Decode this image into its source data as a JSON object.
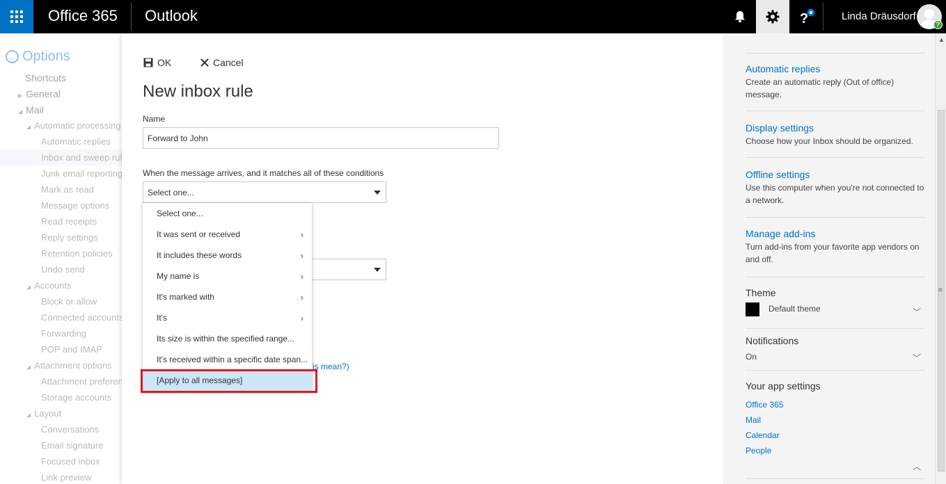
{
  "topbar": {
    "brand": "Office 365",
    "app": "Outlook",
    "user": "Linda Dräusdorf",
    "avatar_badge": "?",
    "icons": [
      "waffle-icon",
      "bell-icon",
      "gear-icon",
      "help-icon"
    ],
    "accent": "#0072c6"
  },
  "leftnav": {
    "title": "Options",
    "items": [
      {
        "label": "Shortcuts"
      },
      {
        "label": "General"
      },
      {
        "label": "Mail"
      },
      {
        "label": "Automatic processing"
      },
      {
        "label": "Automatic replies"
      },
      {
        "label": "Inbox and sweep rules"
      },
      {
        "label": "Junk email reporting"
      },
      {
        "label": "Mark as read"
      },
      {
        "label": "Message options"
      },
      {
        "label": "Read receipts"
      },
      {
        "label": "Reply settings"
      },
      {
        "label": "Retention policies"
      },
      {
        "label": "Undo send"
      },
      {
        "label": "Accounts"
      },
      {
        "label": "Block or allow"
      },
      {
        "label": "Connected accounts"
      },
      {
        "label": "Forwarding"
      },
      {
        "label": "POP and IMAP"
      },
      {
        "label": "Attachment options"
      },
      {
        "label": "Attachment preferences"
      },
      {
        "label": "Storage accounts"
      },
      {
        "label": "Layout"
      },
      {
        "label": "Conversations"
      },
      {
        "label": "Email signature"
      },
      {
        "label": "Focused inbox"
      },
      {
        "label": "Link preview"
      }
    ]
  },
  "main": {
    "ok_label": "OK",
    "cancel_label": "Cancel",
    "title": "New inbox rule",
    "name_label": "Name",
    "name_value": "Forward to John",
    "conditions_label": "When the message arrives, and it matches all of these conditions",
    "conditions_value": "Select one...",
    "second_select_value": "",
    "help_link": "is mean?)"
  },
  "menu": {
    "items": [
      {
        "label": "Select one...",
        "submenu": false
      },
      {
        "label": "It was sent or received",
        "submenu": true
      },
      {
        "label": "It includes these words",
        "submenu": true
      },
      {
        "label": "My name is",
        "submenu": true
      },
      {
        "label": "It's marked with",
        "submenu": true
      },
      {
        "label": "It's",
        "submenu": true
      },
      {
        "label": "Its size is within the specified range...",
        "submenu": false
      },
      {
        "label": "It's received within a specific date span...",
        "submenu": false
      },
      {
        "label": "[Apply to all messages]",
        "submenu": false,
        "highlighted": true
      }
    ],
    "chevron": "›"
  },
  "rightpane": {
    "automatic_replies": {
      "link": "Automatic replies",
      "desc": "Create an automatic reply (Out of office) message."
    },
    "display_settings": {
      "link": "Display settings",
      "desc": "Choose how your Inbox should be organized."
    },
    "offline_settings": {
      "link": "Offline settings",
      "desc": "Use this computer when you're not connected to a network."
    },
    "manage_addins": {
      "link": "Manage add-ins",
      "desc": "Turn add-ins from your favorite app vendors on and off."
    },
    "theme": {
      "heading": "Theme",
      "value": "Default theme"
    },
    "notifications": {
      "heading": "Notifications",
      "value": "On"
    },
    "app_settings": {
      "heading": "Your app settings",
      "links": [
        "Office 365",
        "Mail",
        "Calendar",
        "People"
      ]
    }
  },
  "colors": {
    "accent": "#0072c6",
    "topbar": "#000000",
    "highlight_box": "#e3161d",
    "menu_highlight": "#cde6f7"
  }
}
